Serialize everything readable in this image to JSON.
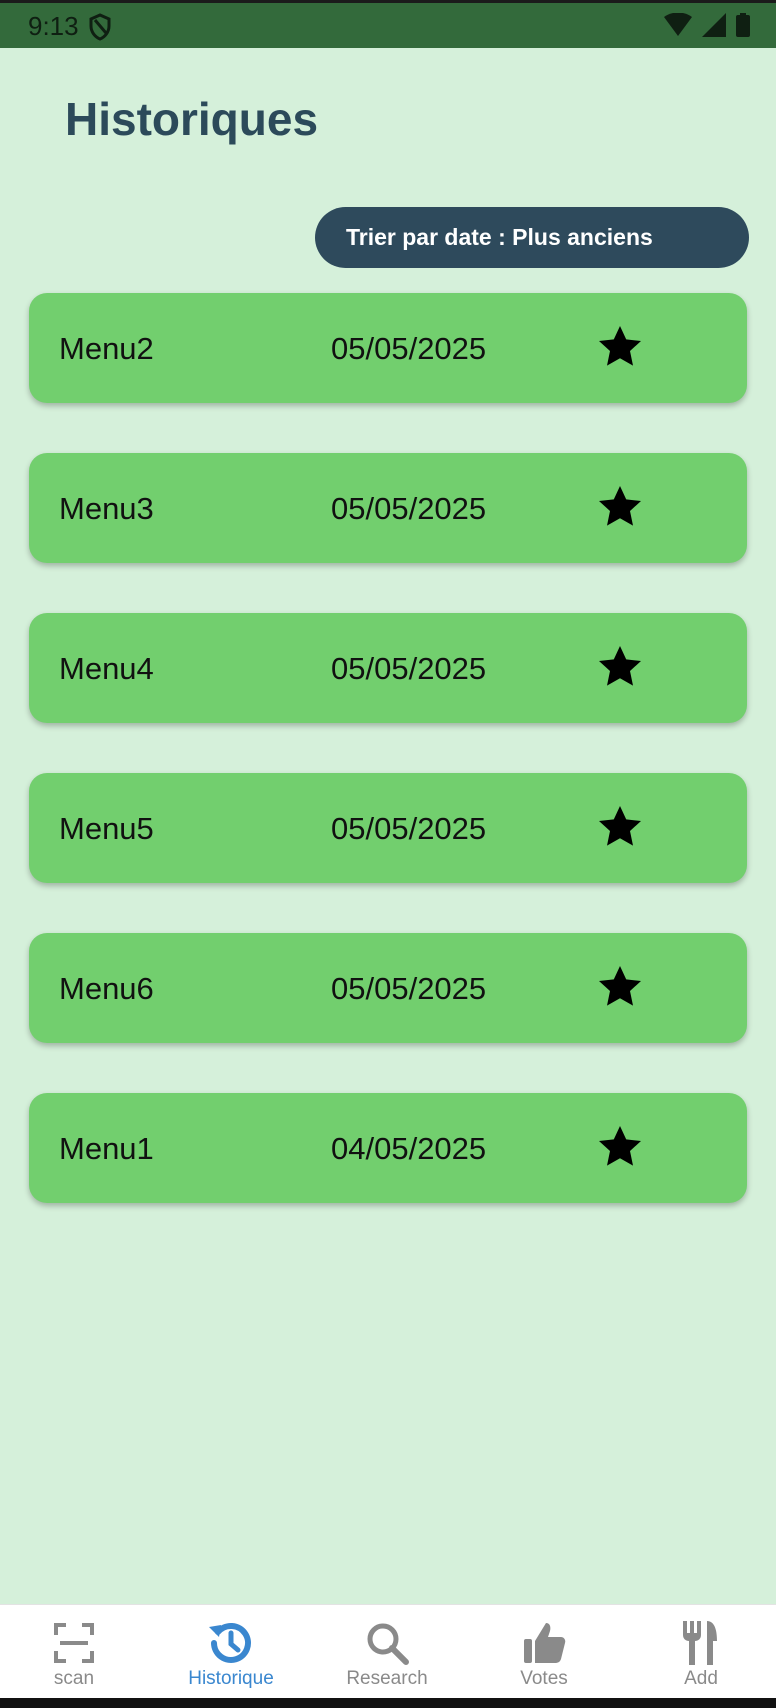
{
  "status_bar": {
    "time": "9:13"
  },
  "page": {
    "title": "Historiques"
  },
  "sort": {
    "label": "Trier par date : Plus anciens"
  },
  "menus": [
    {
      "name": "Menu2",
      "date": "05/05/2025"
    },
    {
      "name": "Menu3",
      "date": "05/05/2025"
    },
    {
      "name": "Menu4",
      "date": "05/05/2025"
    },
    {
      "name": "Menu5",
      "date": "05/05/2025"
    },
    {
      "name": "Menu6",
      "date": "05/05/2025"
    },
    {
      "name": "Menu1",
      "date": "04/05/2025"
    }
  ],
  "bottom_nav": {
    "items": [
      {
        "label": "scan",
        "icon": "scan-icon"
      },
      {
        "label": "Historique",
        "icon": "history-icon"
      },
      {
        "label": "Research",
        "icon": "search-icon"
      },
      {
        "label": "Votes",
        "icon": "thumbs-up-icon"
      },
      {
        "label": "Add",
        "icon": "cutlery-icon"
      }
    ],
    "active_color": "#3a87cf",
    "inactive_color": "#8a8a8a"
  },
  "colors": {
    "background": "#d5f0da",
    "card": "#72cf6e",
    "accent": "#2e4a5c",
    "status_bar": "#336a3b"
  }
}
